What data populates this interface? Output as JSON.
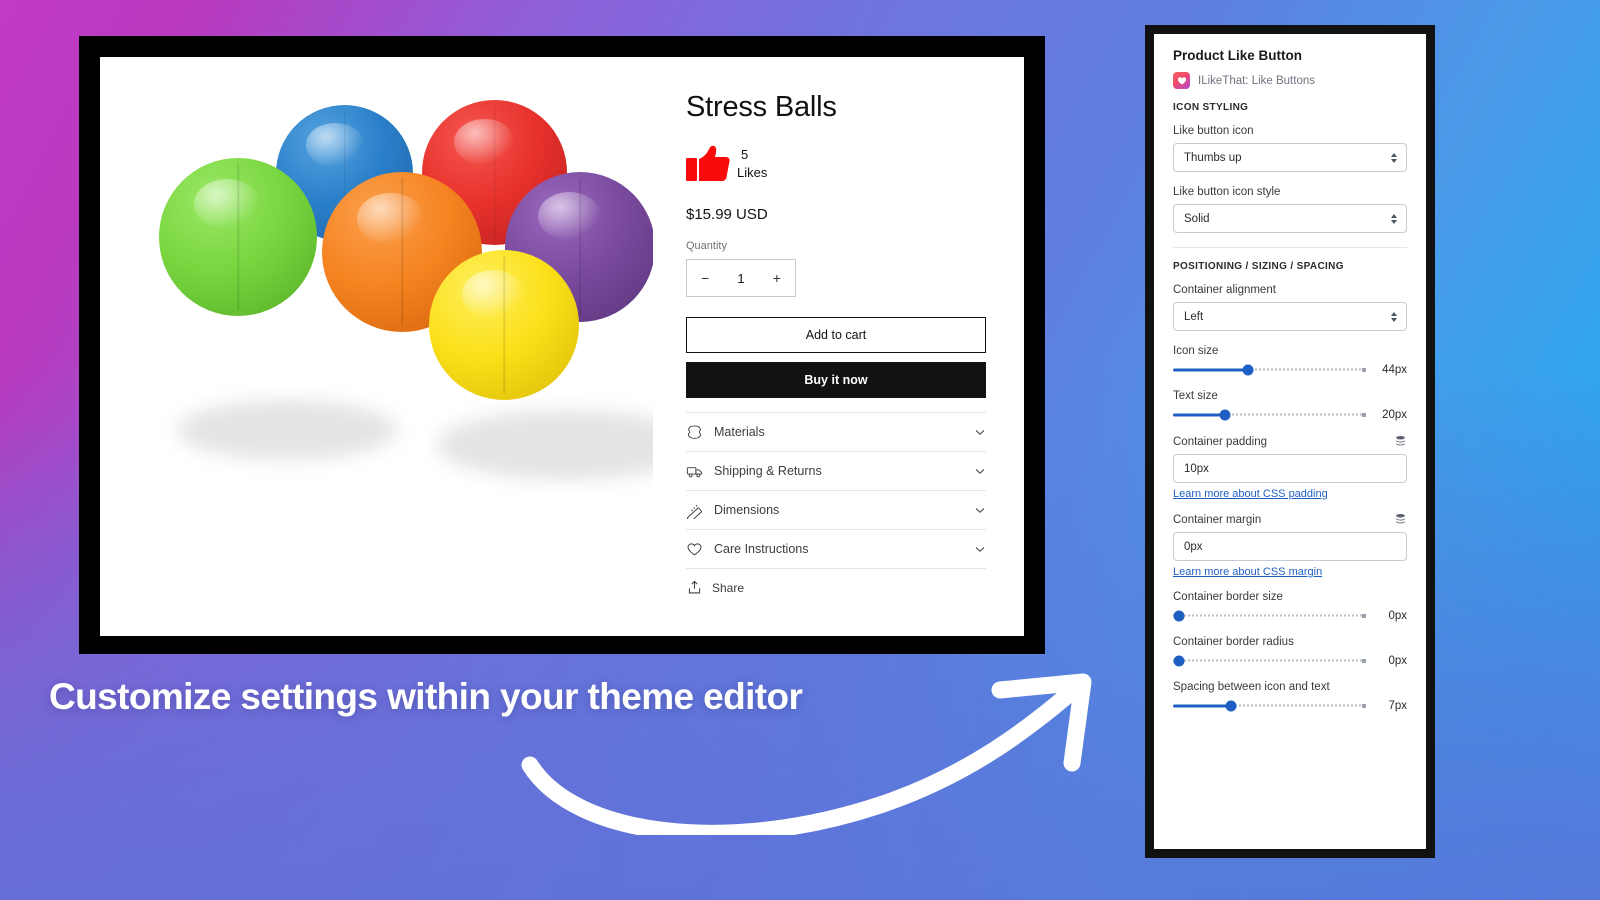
{
  "background": {
    "gradient_from": "#c23ac8",
    "gradient_mid": "#6f74de",
    "gradient_to": "#22abf4"
  },
  "caption": {
    "text": "Customize settings within your theme editor",
    "color": "#ffffff"
  },
  "storefront": {
    "product": {
      "title": "Stress Balls",
      "like_count": "5",
      "like_label": "Likes",
      "like_icon": "thumbs-up-icon",
      "like_icon_color": "#fa0a0a",
      "price": "$15.99 USD",
      "quantity_label": "Quantity",
      "quantity_value": "1",
      "quantity_decrement": "−",
      "quantity_increment": "+",
      "add_to_cart_label": "Add to cart",
      "buy_now_label": "Buy it now",
      "share_label": "Share",
      "share_icon": "share-icon",
      "accordions": [
        {
          "label": "Materials",
          "icon": "hide-icon"
        },
        {
          "label": "Shipping & Returns",
          "icon": "truck-icon"
        },
        {
          "label": "Dimensions",
          "icon": "ruler-icon"
        },
        {
          "label": "Care Instructions",
          "icon": "heart-icon"
        }
      ],
      "media_alt": "Six colored stress balls",
      "ball_colors": [
        "#79d63f",
        "#2a7fc9",
        "#e8312c",
        "#f58320",
        "#7a4a9e",
        "#fbe018"
      ]
    }
  },
  "settings_panel": {
    "title": "Product Like Button",
    "app_name": "ILikeThat: Like Buttons",
    "app_logo_icon": "heart-app-logo-icon",
    "sections": [
      {
        "heading": "ICON STYLING",
        "fields": [
          {
            "label": "Like button icon",
            "type": "select",
            "value": "Thumbs up"
          },
          {
            "label": "Like button icon style",
            "type": "select",
            "value": "Solid"
          }
        ]
      },
      {
        "heading": "POSITIONING / SIZING / SPACING",
        "fields": [
          {
            "label": "Container alignment",
            "type": "select",
            "value": "Left"
          },
          {
            "label": "Icon size",
            "type": "slider",
            "value": "44px",
            "fill_percent": 39
          },
          {
            "label": "Text size",
            "type": "slider",
            "value": "20px",
            "fill_percent": 27
          },
          {
            "label": "Container padding",
            "type": "text",
            "value": "10px",
            "help": "Learn more about CSS padding",
            "icon": "layers-icon"
          },
          {
            "label": "Container margin",
            "type": "text",
            "value": "0px",
            "help": "Learn more about CSS margin",
            "icon": "layers-icon"
          },
          {
            "label": "Container border size",
            "type": "slider",
            "value": "0px",
            "fill_percent": 0
          },
          {
            "label": "Container border radius",
            "type": "slider",
            "value": "0px",
            "fill_percent": 0
          },
          {
            "label": "Spacing between icon and text",
            "type": "slider",
            "value": "7px",
            "fill_percent": 30
          }
        ]
      }
    ],
    "accent_color": "#1f5fc4"
  }
}
